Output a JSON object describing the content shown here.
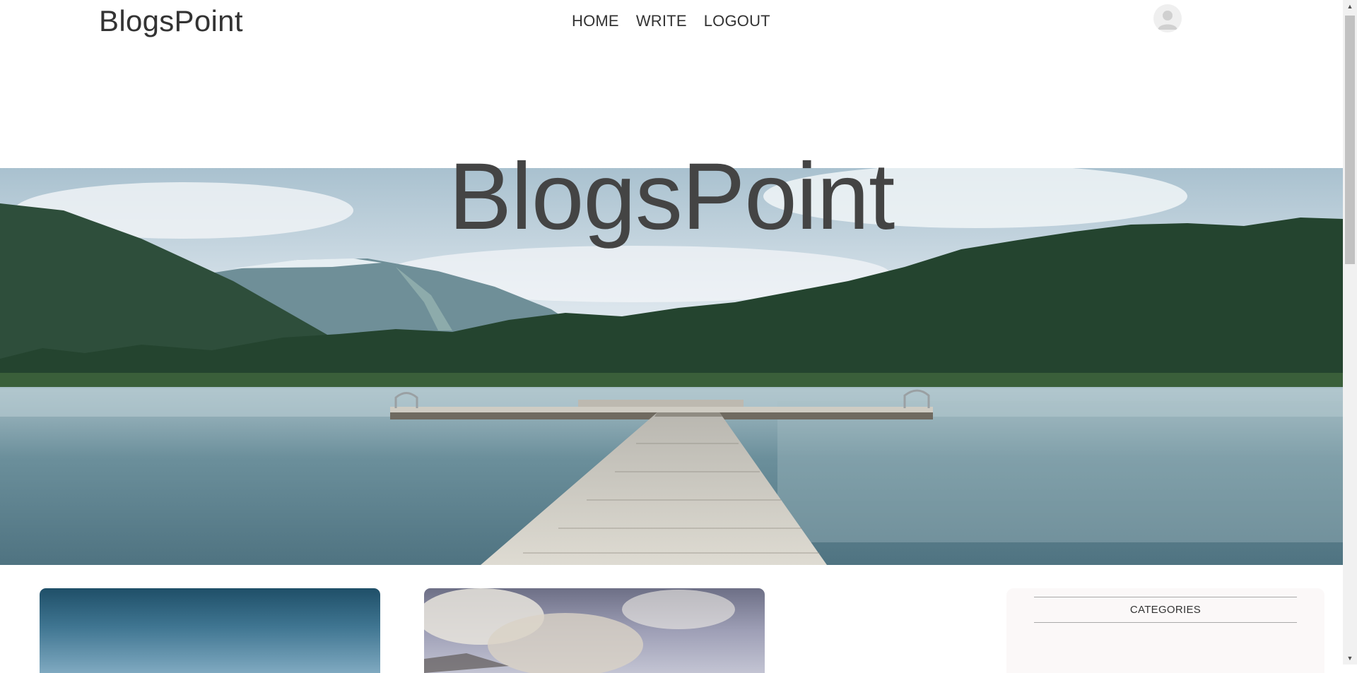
{
  "header": {
    "logo": "BlogsPoint",
    "nav": [
      {
        "label": "HOME"
      },
      {
        "label": "WRITE"
      },
      {
        "label": "LOGOUT"
      }
    ],
    "avatar_icon": "user-avatar-icon"
  },
  "hero": {
    "title": "BlogsPoint",
    "image_description_icon": "lake-dock-landscape-image"
  },
  "posts": [
    {
      "image_icon": "sky-image"
    },
    {
      "image_icon": "clouds-image"
    }
  ],
  "sidebar": {
    "title": "CATEGORIES"
  },
  "colors": {
    "text": "#444444",
    "sidebar_bg": "#fbf8f8"
  }
}
